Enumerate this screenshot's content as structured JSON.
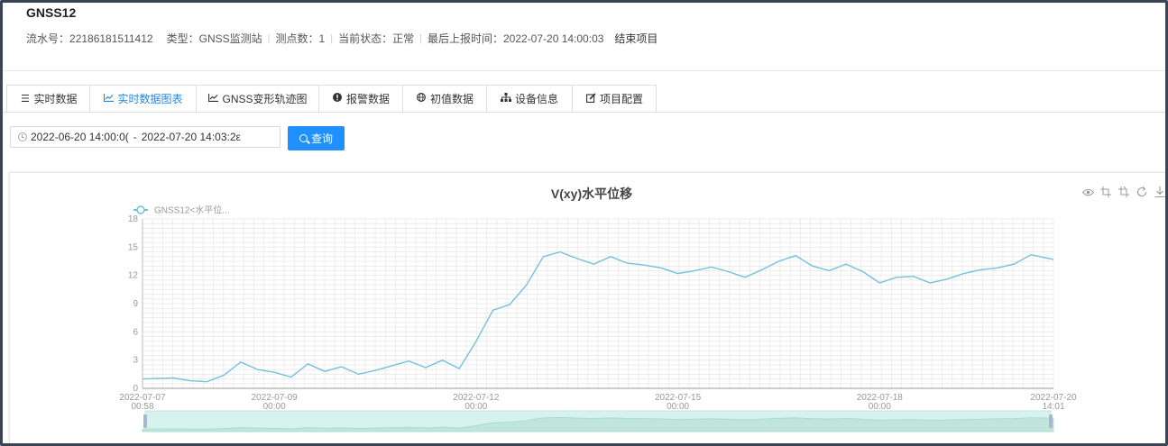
{
  "header": {
    "title": "GNSS12",
    "serial_label": "流水号：",
    "serial": "22186181511412",
    "type_label": "类型：",
    "type": "GNSS监测站",
    "points_label": "测点数：",
    "points": "1",
    "status_label": "当前状态：",
    "status": "正常",
    "last_report_label": "最后上报时间：",
    "last_report": "2022-07-20 14:00:03",
    "end_project": "结束项目"
  },
  "tabs": [
    {
      "label": "实时数据",
      "icon": "list-icon",
      "active": false
    },
    {
      "label": "实时数据图表",
      "icon": "line-chart-icon",
      "active": true
    },
    {
      "label": "GNSS变形轨迹图",
      "icon": "line-chart-icon",
      "active": false
    },
    {
      "label": "报警数据",
      "icon": "alert-icon",
      "active": false
    },
    {
      "label": "初值数据",
      "icon": "globe-icon",
      "active": false
    },
    {
      "label": "设备信息",
      "icon": "sitemap-icon",
      "active": false
    },
    {
      "label": "项目配置",
      "icon": "edit-icon",
      "active": false
    }
  ],
  "query": {
    "start": "2022-06-20 14:00:0(",
    "separator": "-",
    "end": "2022-07-20 14:03:2ε",
    "button_label": "查询"
  },
  "toolbox": [
    "eye-icon",
    "zoom-icon",
    "zoom-reset-icon",
    "restore-icon",
    "download-icon"
  ],
  "colors": {
    "accent": "#1e90ff",
    "series": "#73c0de",
    "zoom_fill": "#d6f2ec"
  },
  "chart_data": {
    "type": "line",
    "title": "V(xy)水平位移",
    "legend": [
      "GNSS12<水平位..."
    ],
    "legend_position": "top-left",
    "grid": true,
    "ylim": [
      0,
      18
    ],
    "y_ticks": [
      0,
      3,
      6,
      9,
      12,
      15,
      18
    ],
    "x_tick_labels": [
      {
        "date": "2022-07-07",
        "time": "00:58"
      },
      {
        "date": "2022-07-09",
        "time": "00:00"
      },
      {
        "date": "2022-07-12",
        "time": "00:00"
      },
      {
        "date": "2022-07-15",
        "time": "00:00"
      },
      {
        "date": "2022-07-18",
        "time": "00:00"
      },
      {
        "date": "2022-07-20",
        "time": "14:01"
      }
    ],
    "x_range": [
      "2022-07-07 00:58",
      "2022-07-20 14:01"
    ],
    "series": [
      {
        "name": "GNSS12<水平位...",
        "x": [
          "2022-07-07 00:58",
          "2022-07-07 12:00",
          "2022-07-07 18:00",
          "2022-07-08 00:00",
          "2022-07-08 06:00",
          "2022-07-08 12:00",
          "2022-07-08 18:00",
          "2022-07-09 00:00",
          "2022-07-09 06:00",
          "2022-07-09 12:00",
          "2022-07-09 18:00",
          "2022-07-10 00:00",
          "2022-07-10 06:00",
          "2022-07-10 12:00",
          "2022-07-10 18:00",
          "2022-07-11 00:00",
          "2022-07-11 06:00",
          "2022-07-11 12:00",
          "2022-07-11 18:00",
          "2022-07-12 00:00",
          "2022-07-12 06:00",
          "2022-07-12 12:00",
          "2022-07-12 18:00",
          "2022-07-13 00:00",
          "2022-07-13 06:00",
          "2022-07-13 12:00",
          "2022-07-13 18:00",
          "2022-07-14 00:00",
          "2022-07-14 06:00",
          "2022-07-14 12:00",
          "2022-07-14 18:00",
          "2022-07-15 00:00",
          "2022-07-15 06:00",
          "2022-07-15 12:00",
          "2022-07-15 18:00",
          "2022-07-16 00:00",
          "2022-07-16 06:00",
          "2022-07-16 12:00",
          "2022-07-16 18:00",
          "2022-07-17 00:00",
          "2022-07-17 06:00",
          "2022-07-17 12:00",
          "2022-07-17 18:00",
          "2022-07-18 00:00",
          "2022-07-18 06:00",
          "2022-07-18 12:00",
          "2022-07-18 18:00",
          "2022-07-19 00:00",
          "2022-07-19 06:00",
          "2022-07-19 12:00",
          "2022-07-19 18:00",
          "2022-07-20 00:00",
          "2022-07-20 06:00",
          "2022-07-20 14:01"
        ],
        "values": [
          1.0,
          1.1,
          0.8,
          0.7,
          1.4,
          2.8,
          2.0,
          1.7,
          1.2,
          2.6,
          1.8,
          2.3,
          1.5,
          1.9,
          2.4,
          2.9,
          2.2,
          3.0,
          2.1,
          5.0,
          8.3,
          8.9,
          11.0,
          14.0,
          14.5,
          13.8,
          13.2,
          14.0,
          13.3,
          13.1,
          12.8,
          12.2,
          12.5,
          12.9,
          12.4,
          11.8,
          12.6,
          13.5,
          14.1,
          13.0,
          12.5,
          13.2,
          12.4,
          11.2,
          11.8,
          11.9,
          11.2,
          11.6,
          12.2,
          12.6,
          12.8,
          13.2,
          14.2,
          13.7
        ]
      }
    ]
  }
}
